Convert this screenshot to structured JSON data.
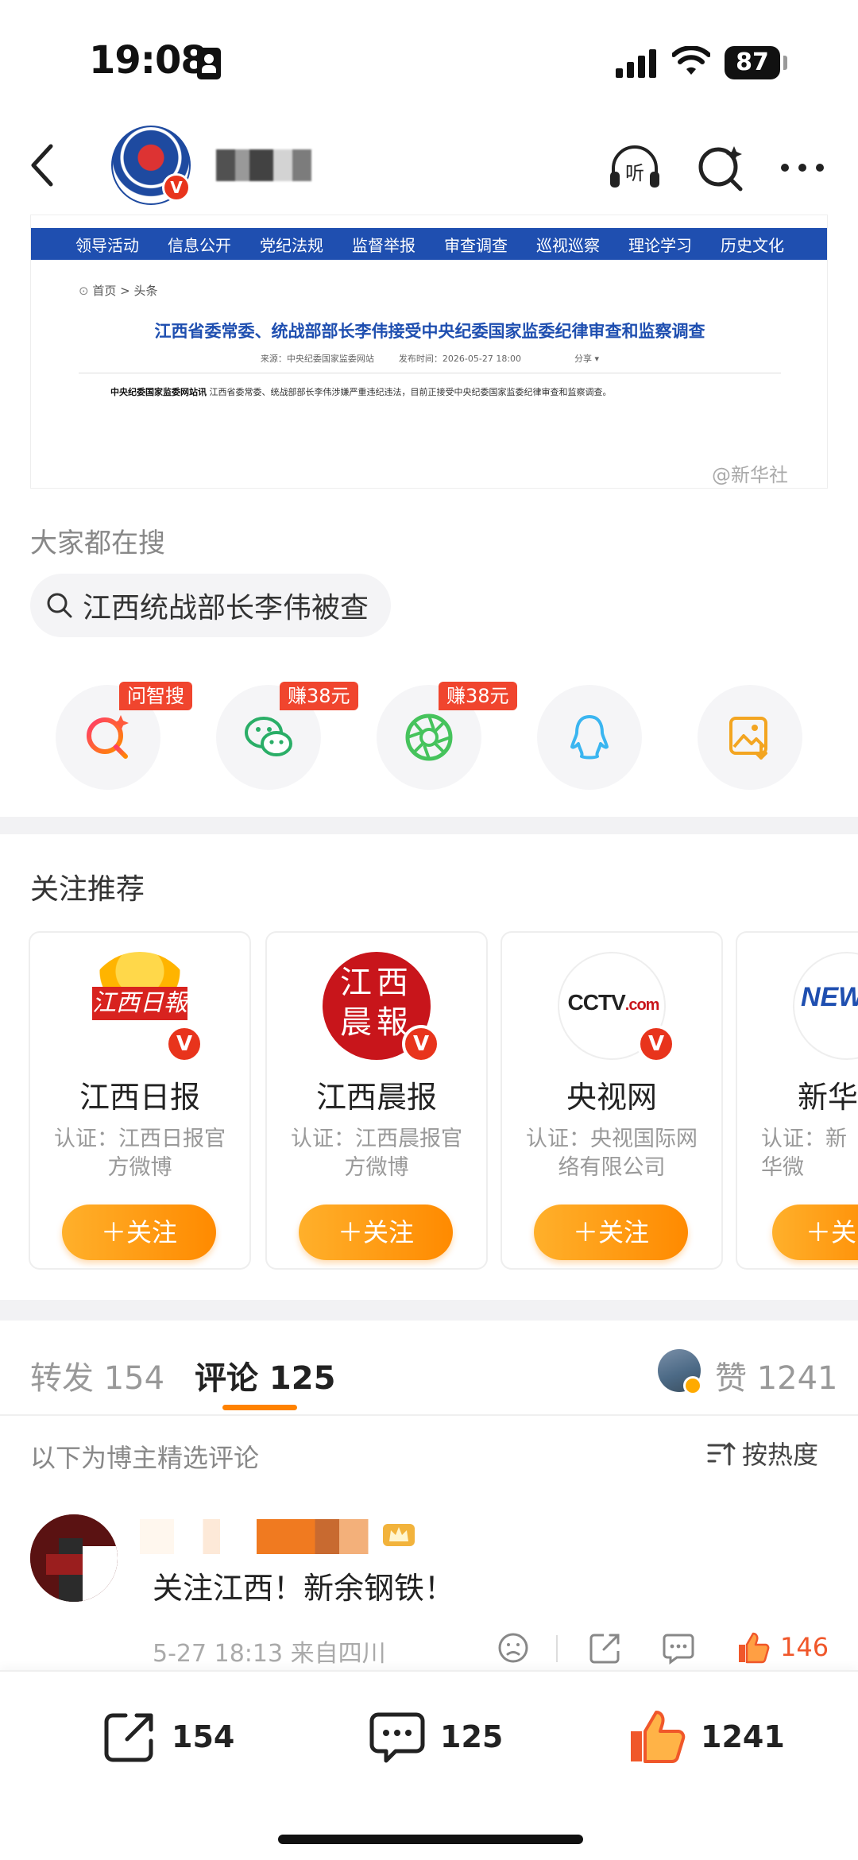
{
  "status_bar": {
    "time": "19:08",
    "battery": "87"
  },
  "article": {
    "nav_items": [
      "领导活动",
      "信息公开",
      "党纪法规",
      "监督举报",
      "审查调查",
      "巡视巡察",
      "理论学习",
      "历史文化"
    ],
    "breadcrumb": "首页 > 头条",
    "title": "江西省委常委、统战部部长李伟接受中央纪委国家监委纪律审查和监察调查",
    "meta_source": "来源：中央纪委国家监委网站",
    "meta_time": "发布时间：2026-05-27 18:00",
    "meta_share": "分享",
    "lead_source": "中央纪委国家监委网站讯",
    "lead_text": "江西省委常委、统战部部长李伟涉嫌严重违纪违法，目前正接受中央纪委国家监委纪律审查和监察调查。",
    "watermark": "@新华社"
  },
  "hot_search": {
    "label": "大家都在搜",
    "query": "江西统战部长李伟被查"
  },
  "share_row": [
    {
      "icon": "ai-search-icon",
      "badge": "问智搜",
      "color": "#f0452e"
    },
    {
      "icon": "wechat-icon",
      "badge": "赚38元",
      "color": "#2aae67"
    },
    {
      "icon": "moments-icon",
      "badge": "赚38元",
      "color": "#46c35c"
    },
    {
      "icon": "qq-icon",
      "badge": "",
      "color": "#3ab5f0"
    },
    {
      "icon": "save-image-icon",
      "badge": "",
      "color": "#f3a521"
    }
  ],
  "follow_recommend": {
    "title": "关注推荐",
    "cards": [
      {
        "name": "江西日报",
        "desc": "认证：江西日报官方微博",
        "button": "＋关注"
      },
      {
        "name": "江西晨报",
        "desc": "认证：江西晨报官方微博",
        "button": "＋关注"
      },
      {
        "name": "央视网",
        "desc": "认证：央视国际网络有限公司",
        "button": "＋关注"
      },
      {
        "name": "新华",
        "desc": "认证：新华微",
        "button": "＋关"
      }
    ]
  },
  "tabs": {
    "repost": "转发 154",
    "comment": "评论 125",
    "like": "赞 1241"
  },
  "comments_header": {
    "label": "以下为博主精选评论",
    "sort": "按热度"
  },
  "comment": {
    "text": "关注江西！新余钢铁！",
    "meta": "5-27 18:13 来自四川",
    "likes": "146"
  },
  "bottom_bar": {
    "repost": "154",
    "comment": "125",
    "like": "1241"
  },
  "colors": {
    "accent": "#ff8200",
    "nav_blue": "#1f4fb0",
    "verified_red": "#e8341c"
  }
}
